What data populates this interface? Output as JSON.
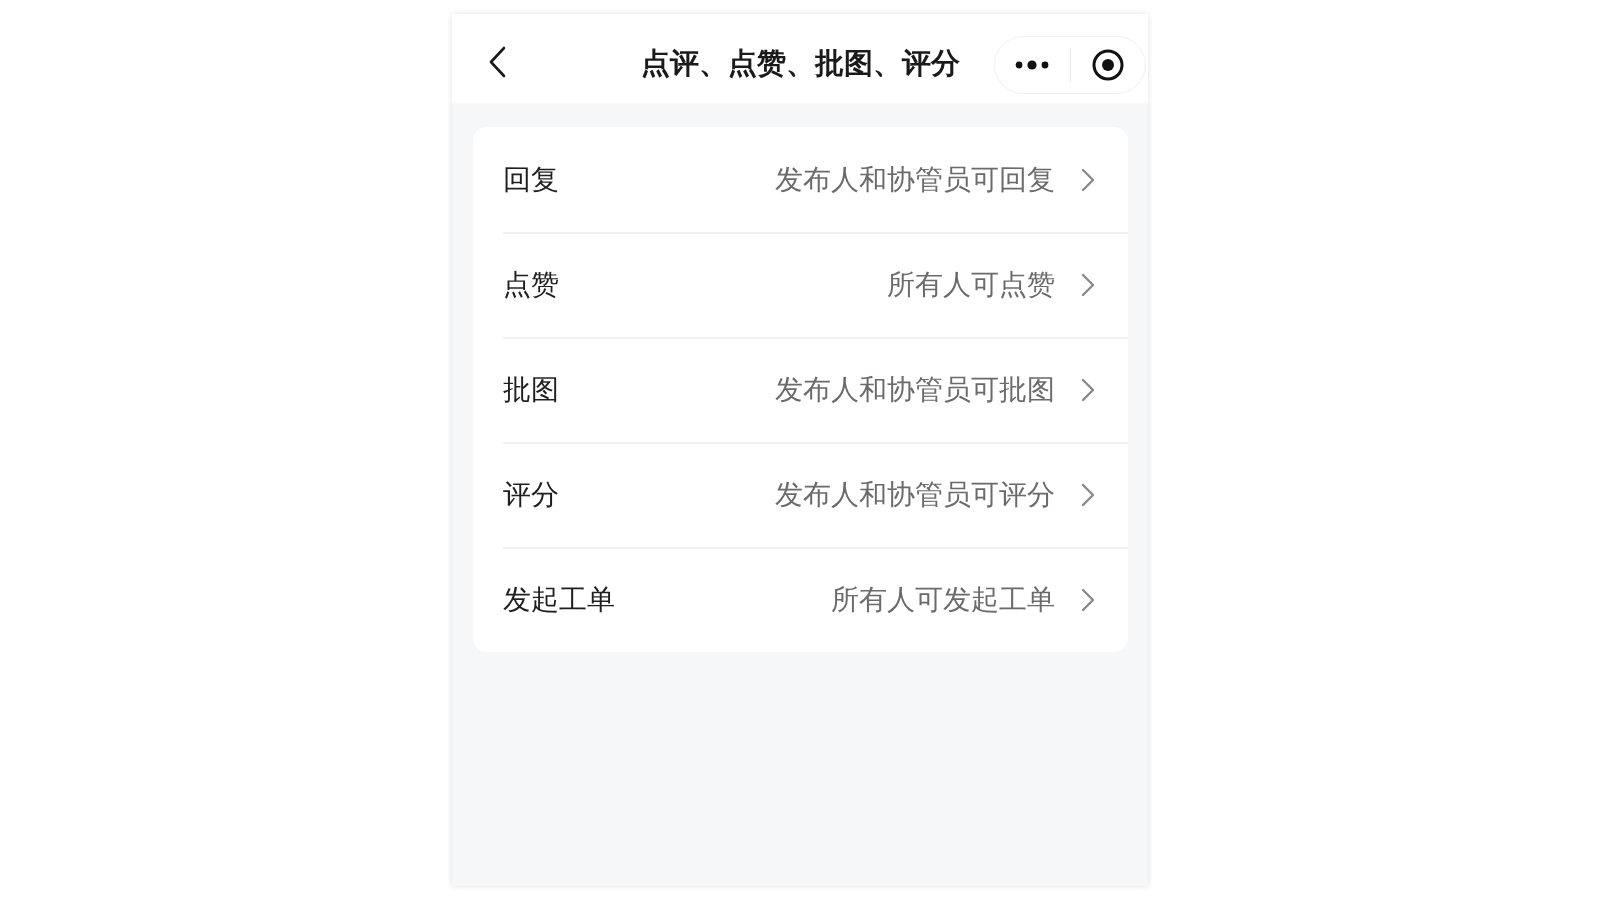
{
  "nav_bar": {
    "title": "点评、点赞、批图、评分"
  },
  "settings": [
    {
      "label": "回复",
      "value": "发布人和协管员可回复"
    },
    {
      "label": "点赞",
      "value": "所有人可点赞"
    },
    {
      "label": "批图",
      "value": "发布人和协管员可批图"
    },
    {
      "label": "评分",
      "value": "发布人和协管员可评分"
    },
    {
      "label": "发起工单",
      "value": "所有人可发起工单"
    }
  ]
}
